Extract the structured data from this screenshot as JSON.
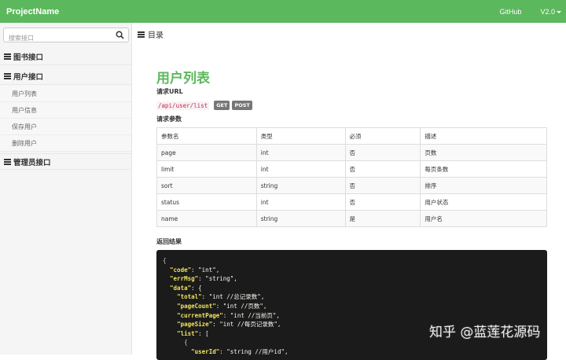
{
  "app": {
    "brand": "ProjectName",
    "github": "GitHub",
    "version": "V2.0"
  },
  "sidebar": {
    "search_placeholder": "搜索接口",
    "sections": [
      {
        "label": "图书接口"
      },
      {
        "label": "用户接口",
        "items": [
          "用户列表",
          "用户信息",
          "保存用户",
          "删除用户"
        ]
      },
      {
        "label": "管理员接口"
      }
    ]
  },
  "toc_label": "目录",
  "main": {
    "title": "用户列表",
    "url_label": "请求URL",
    "url": "/api/user/list",
    "methods": [
      "GET",
      "POST"
    ],
    "params_label": "请求参数",
    "table": {
      "headers": [
        "参数名",
        "类型",
        "必须",
        "描述"
      ],
      "rows": [
        [
          "page",
          "int",
          "否",
          "页数"
        ],
        [
          "limit",
          "int",
          "否",
          "每页条数"
        ],
        [
          "sort",
          "string",
          "否",
          "排序"
        ],
        [
          "status",
          "int",
          "否",
          "用户状态"
        ],
        [
          "name",
          "string",
          "是",
          "用户名"
        ]
      ]
    },
    "result_label": "返回结果",
    "code_lines": [
      {
        "indent": "",
        "key": "",
        "value": "{"
      },
      {
        "indent": "  ",
        "key": "\"code\"",
        "value": ": \"int\","
      },
      {
        "indent": "  ",
        "key": "\"errMsg\"",
        "value": ": \"string\","
      },
      {
        "indent": "  ",
        "key": "\"data\"",
        "value": ": {"
      },
      {
        "indent": "    ",
        "key": "\"total\"",
        "value": ": \"int //总记录数\","
      },
      {
        "indent": "    ",
        "key": "\"pageCount\"",
        "value": ": \"int //页数\","
      },
      {
        "indent": "    ",
        "key": "\"currentPage\"",
        "value": ": \"int //当前页\","
      },
      {
        "indent": "    ",
        "key": "\"pageSize\"",
        "value": ": \"int //每页记录数\","
      },
      {
        "indent": "    ",
        "key": "\"list\"",
        "value": ": ["
      },
      {
        "indent": "      ",
        "key": "",
        "value": "{"
      },
      {
        "indent": "        ",
        "key": "\"userId\"",
        "value": ": \"string //用户id\","
      }
    ]
  },
  "watermark": "知乎 @蓝莲花源码"
}
